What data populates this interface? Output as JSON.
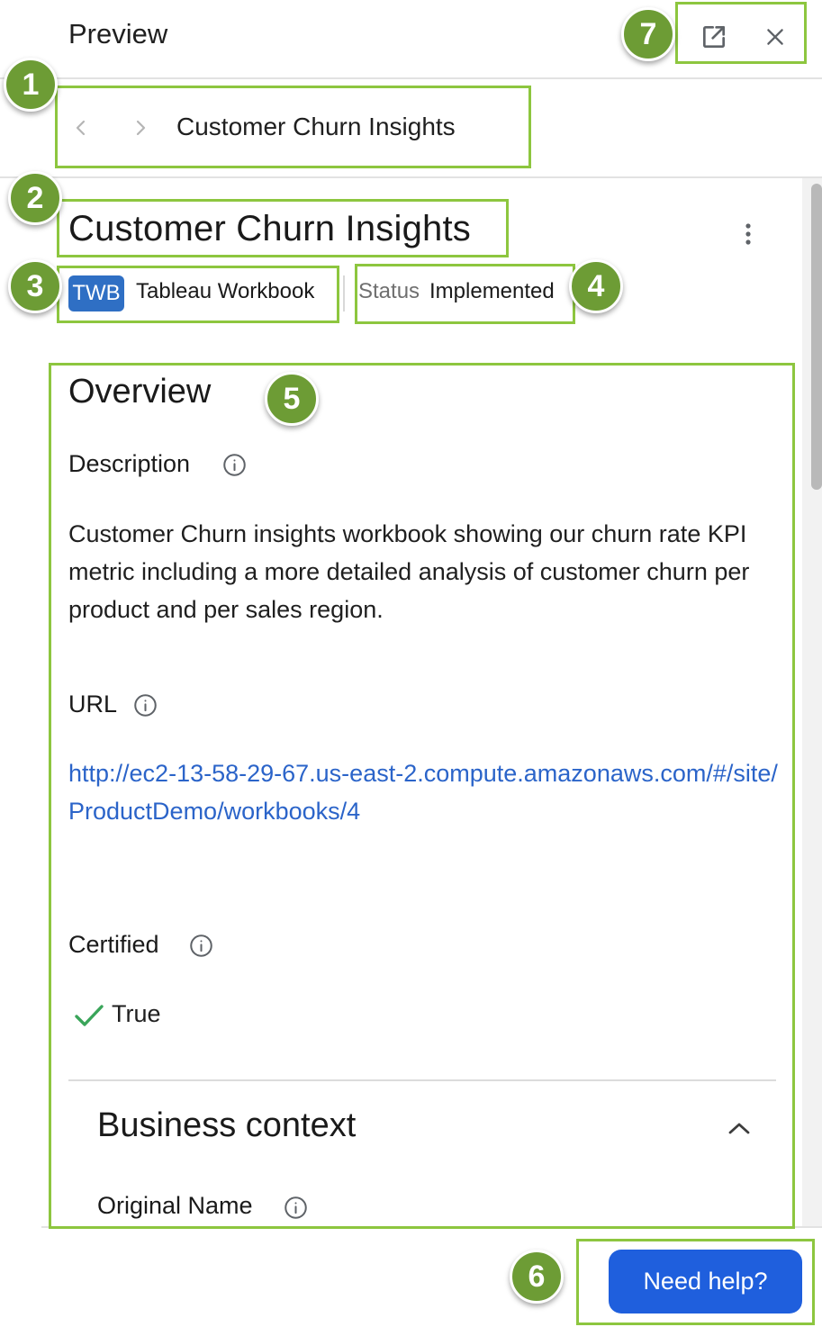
{
  "header": {
    "title": "Preview"
  },
  "breadcrumb": {
    "label": "Customer Churn Insights"
  },
  "entity": {
    "title": "Customer Churn Insights",
    "type_tag": "TWB",
    "type_label": "Tableau Workbook",
    "status_key": "Status",
    "status_value": "Implemented"
  },
  "overview": {
    "heading": "Overview",
    "description_label": "Description",
    "description_text": "Customer Churn insights workbook showing our churn rate KPI metric including a more detailed analysis of customer churn per product and per sales region.",
    "url_label": "URL",
    "url_value": "http://ec2-13-58-29-67.us-east-2.compute.amazonaws.com/#/site/ProductDemo/workbooks/4",
    "certified_label": "Certified",
    "certified_value": "True"
  },
  "business_context": {
    "heading": "Business context",
    "original_name_label": "Original Name"
  },
  "footer": {
    "help_label": "Need help?"
  },
  "callouts": [
    "1",
    "2",
    "3",
    "4",
    "5",
    "6",
    "7"
  ],
  "colors": {
    "accent": "#1f5fdd",
    "link": "#2b64c9",
    "highlight": "#8dc63f",
    "badge": "#6d9c35",
    "tag": "#2f6fc4",
    "check": "#3aa55a"
  }
}
